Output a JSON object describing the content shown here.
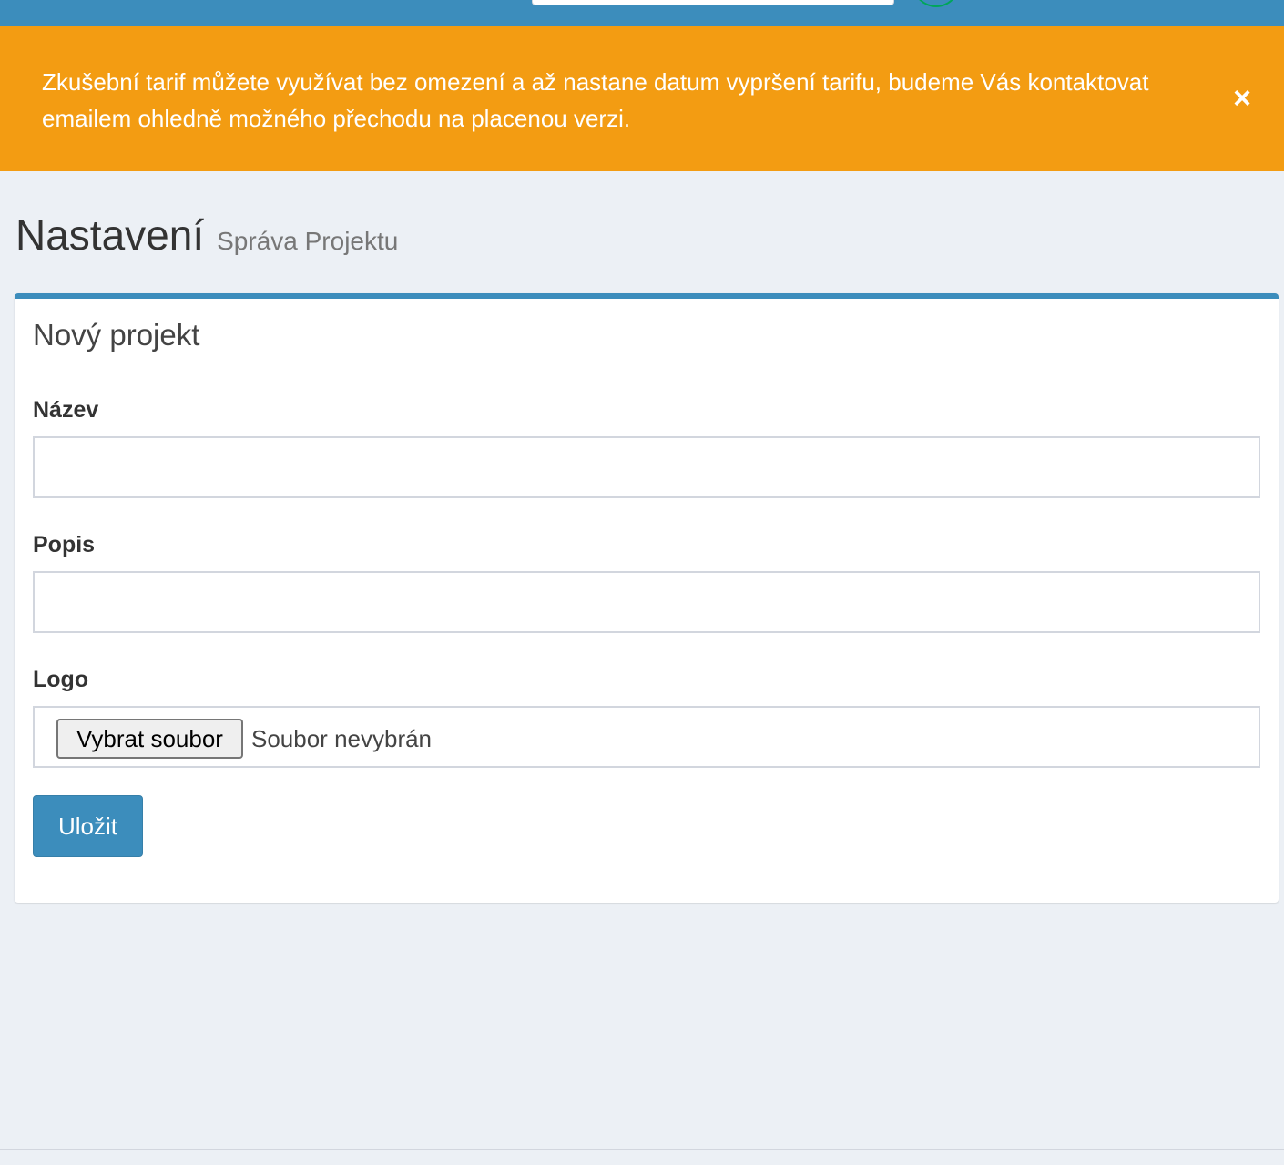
{
  "alert": {
    "message": "Zkušební tarif můžete využívat bez omezení a až nastane datum vypršení tarifu, budeme Vás kontaktovat emailem ohledně možného přechodu na placenou verzi.",
    "close_label": "×",
    "color": "#f39c12"
  },
  "header": {
    "title": "Nastavení",
    "subtitle": "Správa Projektu"
  },
  "form": {
    "box_title": "Nový projekt",
    "name_label": "Název",
    "name_value": "",
    "description_label": "Popis",
    "description_value": "",
    "logo_label": "Logo",
    "file_button_label": "Vybrat soubor",
    "file_status": "Soubor nevybrán",
    "save_label": "Uložit"
  },
  "colors": {
    "accent": "#3c8dbc",
    "warning": "#f39c12",
    "background": "#ecf0f5"
  }
}
